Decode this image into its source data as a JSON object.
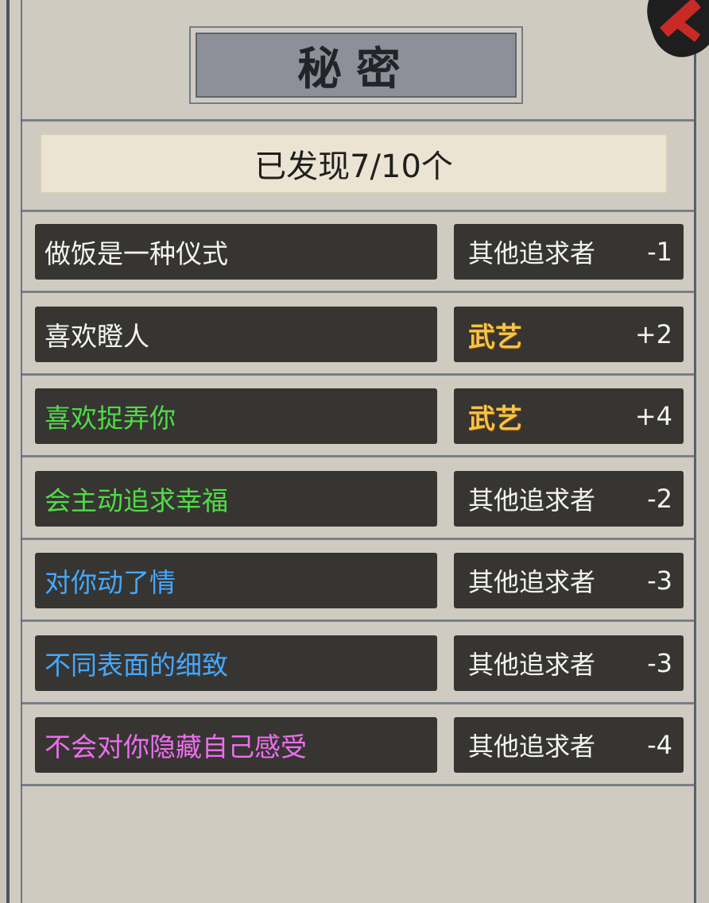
{
  "header": {
    "title": "秘密"
  },
  "status": {
    "found_label": "已发现7/10个"
  },
  "colors": {
    "white": "#f4f4f4",
    "green": "#4fdc46",
    "blue": "#44a8ff",
    "pink": "#ee6ef0",
    "gold": "#f2c44a"
  },
  "secrets": [
    {
      "text": "做饭是一种仪式",
      "color": "white",
      "attribute": "其他追求者",
      "attribute_style": "plain",
      "value": "-1"
    },
    {
      "text": "喜欢瞪人",
      "color": "white",
      "attribute": "武艺",
      "attribute_style": "gold",
      "value": "+2"
    },
    {
      "text": "喜欢捉弄你",
      "color": "green",
      "attribute": "武艺",
      "attribute_style": "gold",
      "value": "+4"
    },
    {
      "text": "会主动追求幸福",
      "color": "green",
      "attribute": "其他追求者",
      "attribute_style": "plain",
      "value": "-2"
    },
    {
      "text": "对你动了情",
      "color": "blue",
      "attribute": "其他追求者",
      "attribute_style": "plain",
      "value": "-3"
    },
    {
      "text": "不同表面的细致",
      "color": "blue",
      "attribute": "其他追求者",
      "attribute_style": "plain",
      "value": "-3"
    },
    {
      "text": "不会对你隐藏自己感受",
      "color": "pink",
      "attribute": "其他追求者",
      "attribute_style": "plain",
      "value": "-4"
    }
  ]
}
